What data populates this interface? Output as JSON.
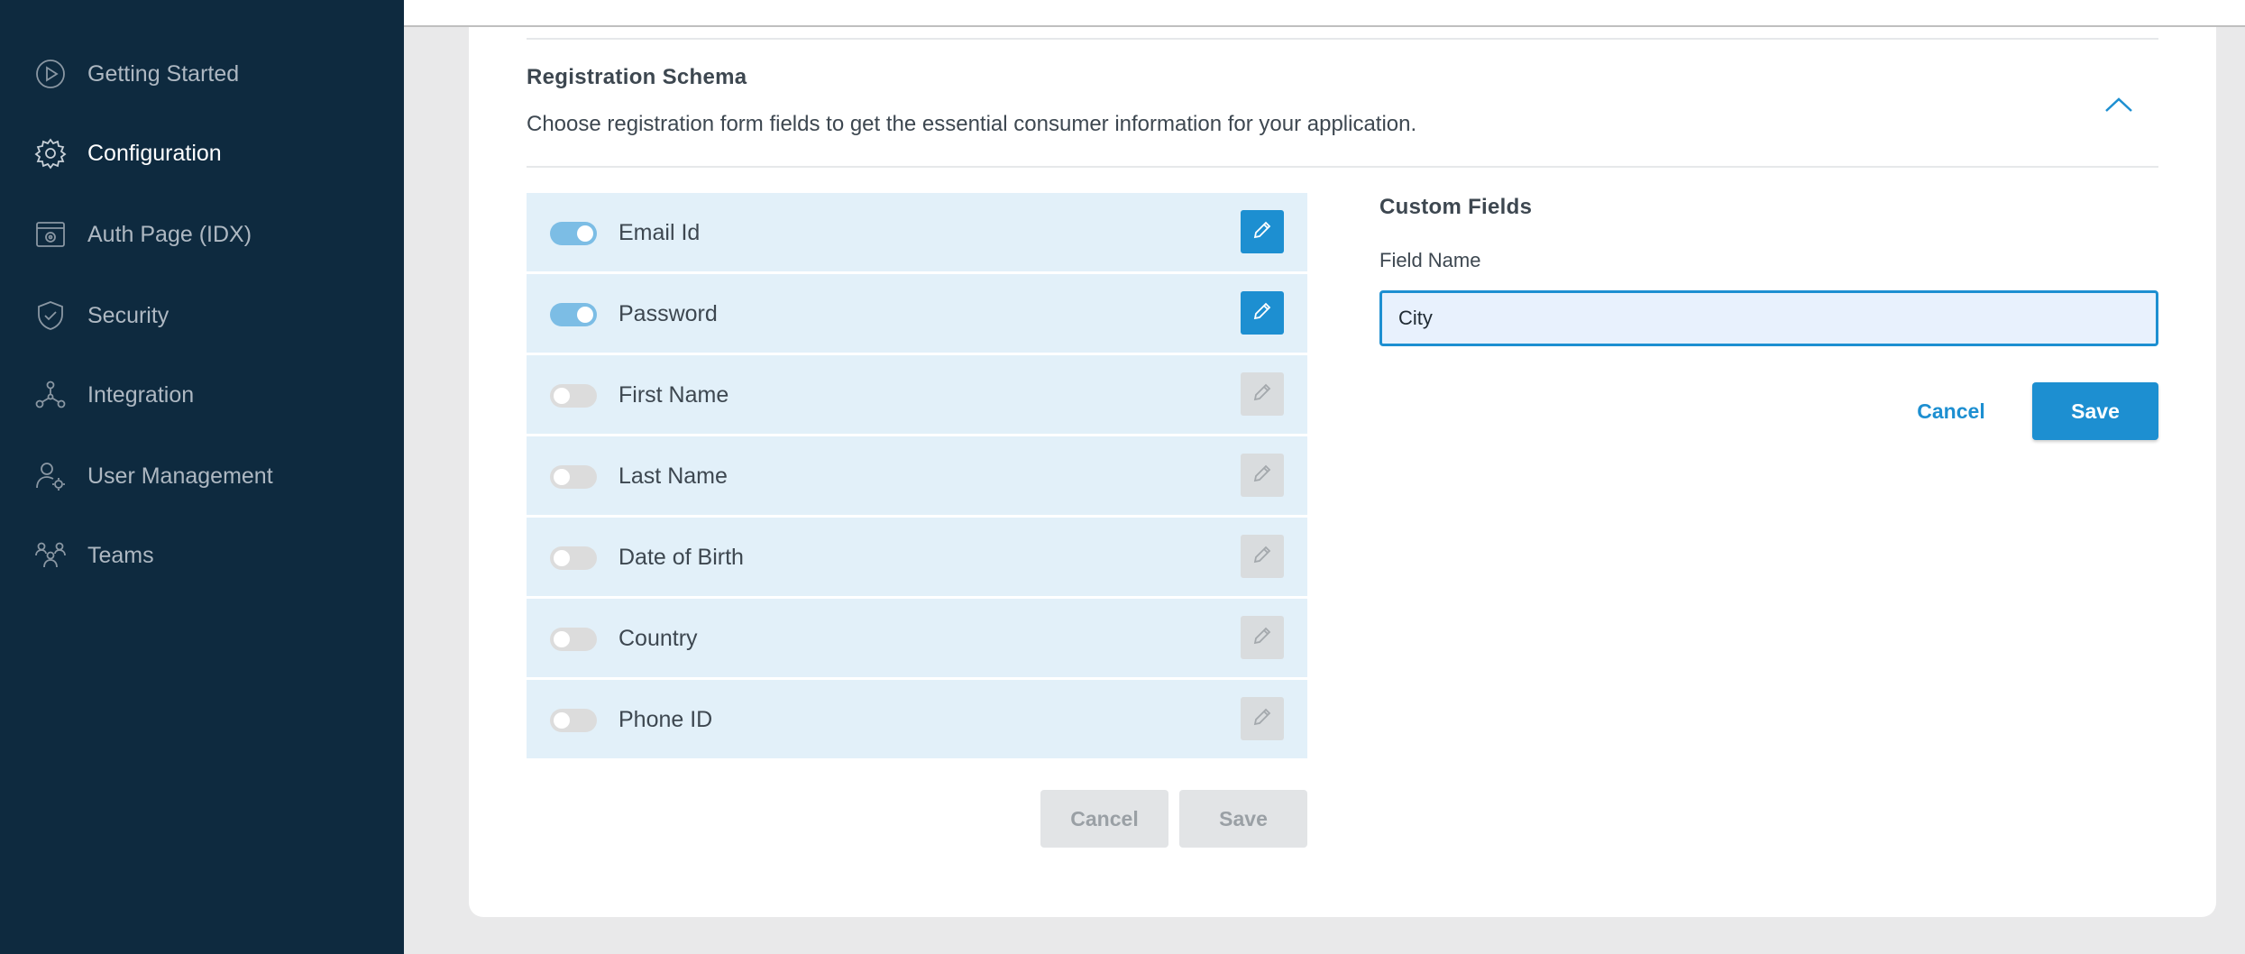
{
  "sidebar": {
    "items": [
      {
        "label": "Getting Started",
        "icon": "play-circle-icon",
        "active": false
      },
      {
        "label": "Configuration",
        "icon": "gear-icon",
        "active": true
      },
      {
        "label": "Auth Page (IDX)",
        "icon": "browser-gear-icon",
        "active": false
      },
      {
        "label": "Security",
        "icon": "shield-check-icon",
        "active": false
      },
      {
        "label": "Integration",
        "icon": "network-nodes-icon",
        "active": false
      },
      {
        "label": "User Management",
        "icon": "user-gear-icon",
        "active": false
      },
      {
        "label": "Teams",
        "icon": "team-icon",
        "active": false
      }
    ]
  },
  "section": {
    "title": "Registration Schema",
    "description": "Choose registration form fields to get the essential consumer information for your application."
  },
  "fields": [
    {
      "label": "Email Id",
      "enabled": true
    },
    {
      "label": "Password",
      "enabled": true
    },
    {
      "label": "First Name",
      "enabled": false
    },
    {
      "label": "Last Name",
      "enabled": false
    },
    {
      "label": "Date of Birth",
      "enabled": false
    },
    {
      "label": "Country",
      "enabled": false
    },
    {
      "label": "Phone ID",
      "enabled": false
    }
  ],
  "fields_actions": {
    "cancel_label": "Cancel",
    "save_label": "Save"
  },
  "custom_fields": {
    "title": "Custom Fields",
    "field_name_label": "Field Name",
    "field_name_value": "City",
    "cancel_label": "Cancel",
    "save_label": "Save"
  },
  "colors": {
    "sidebar_bg": "#0e2a3f",
    "accent": "#1d8fd1",
    "row_bg": "#e2f0f9",
    "toggle_on": "#7cbde5"
  }
}
